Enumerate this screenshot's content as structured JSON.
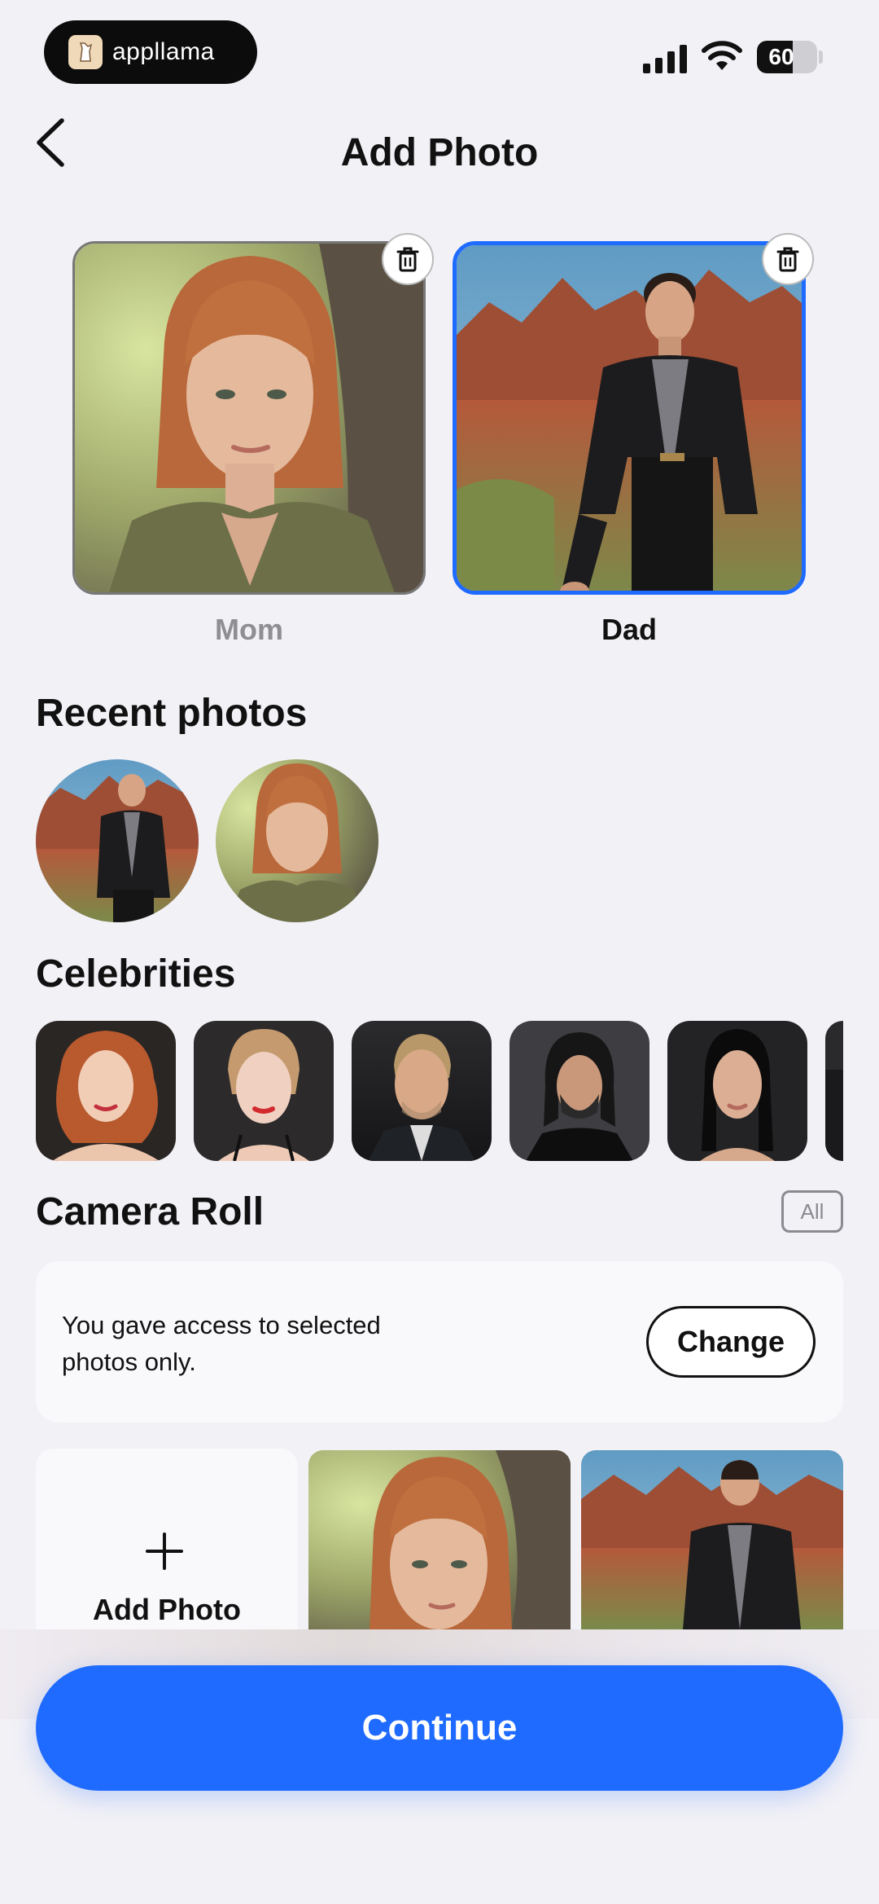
{
  "status_bar": {
    "brand_name": "appllama",
    "battery_level": "60",
    "battery_fraction": 0.6
  },
  "header": {
    "title": "Add Photo",
    "back_icon": "chevron-left-icon"
  },
  "selected_photos": [
    {
      "label": "Mom",
      "selected": false,
      "label_color": "#8e8e93"
    },
    {
      "label": "Dad",
      "selected": true,
      "label_color": "#111111"
    }
  ],
  "recent": {
    "title": "Recent photos"
  },
  "celebrities": {
    "title": "Celebrities"
  },
  "camera_roll": {
    "title": "Camera Roll",
    "all_label": "All",
    "access_message": "You gave access to selected photos only.",
    "change_label": "Change",
    "add_photo_label": "Add Photo"
  },
  "footer": {
    "continue_label": "Continue"
  },
  "colors": {
    "accent": "#1f6bff",
    "background": "#f2f1f6"
  }
}
